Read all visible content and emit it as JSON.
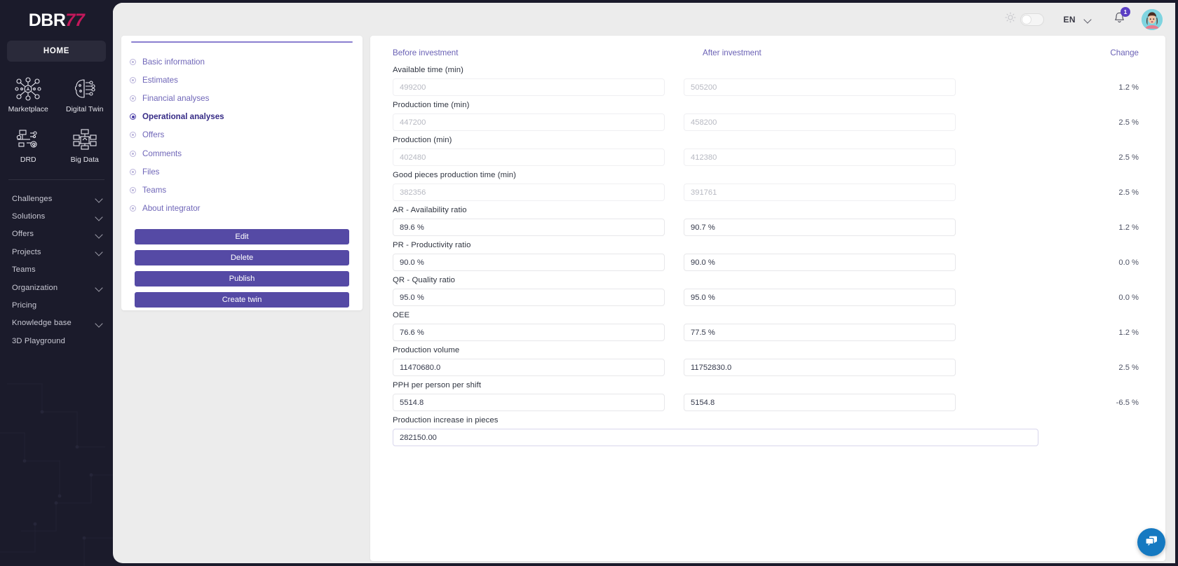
{
  "brand": {
    "name_main": "DBR",
    "name_accent": "77"
  },
  "sidebar": {
    "home_label": "HOME",
    "quick_items": [
      {
        "label": "Marketplace",
        "icon": "marketplace-icon"
      },
      {
        "label": "Digital Twin",
        "icon": "digital-twin-icon"
      },
      {
        "label": "DRD",
        "icon": "drd-icon"
      },
      {
        "label": "Big Data",
        "icon": "big-data-icon"
      }
    ],
    "nav_items": [
      {
        "label": "Challenges",
        "expandable": true
      },
      {
        "label": "Solutions",
        "expandable": true
      },
      {
        "label": "Offers",
        "expandable": true
      },
      {
        "label": "Projects",
        "expandable": true
      },
      {
        "label": "Teams",
        "expandable": false
      },
      {
        "label": "Organization",
        "expandable": true
      },
      {
        "label": "Pricing",
        "expandable": false
      },
      {
        "label": "Knowledge base",
        "expandable": true
      },
      {
        "label": "3D Playground",
        "expandable": false
      }
    ]
  },
  "topbar": {
    "sun_icon": "sun-icon",
    "theme_toggle": "theme-toggle",
    "language": "EN",
    "bell_icon": "bell-icon",
    "notification_count": "1",
    "avatar": "user-avatar"
  },
  "left_panel": {
    "sections": [
      {
        "label": "Basic information",
        "active": false
      },
      {
        "label": "Estimates",
        "active": false
      },
      {
        "label": "Financial analyses",
        "active": false
      },
      {
        "label": "Operational analyses",
        "active": true
      },
      {
        "label": "Offers",
        "active": false
      },
      {
        "label": "Comments",
        "active": false
      },
      {
        "label": "Files",
        "active": false
      },
      {
        "label": "Teams",
        "active": false
      },
      {
        "label": "About integrator",
        "active": false
      }
    ],
    "buttons": [
      {
        "label": "Edit"
      },
      {
        "label": "Delete"
      },
      {
        "label": "Publish"
      },
      {
        "label": "Create twin"
      }
    ]
  },
  "main": {
    "columns": {
      "before": "Before investment",
      "after": "After investment",
      "change": "Change"
    },
    "rows": [
      {
        "label": "Available time (min)",
        "before": "499200",
        "after": "505200",
        "change": "1.2 %",
        "muted": true
      },
      {
        "label": "Production time (min)",
        "before": "447200",
        "after": "458200",
        "change": "2.5 %",
        "muted": true
      },
      {
        "label": "Production (min)",
        "before": "402480",
        "after": "412380",
        "change": "2.5 %",
        "muted": true
      },
      {
        "label": "Good pieces production time (min)",
        "before": "382356",
        "after": "391761",
        "change": "2.5 %",
        "muted": true
      },
      {
        "label": "AR - Availability ratio",
        "before": "89.6 %",
        "after": "90.7 %",
        "change": "1.2 %",
        "muted": false
      },
      {
        "label": "PR - Productivity ratio",
        "before": "90.0 %",
        "after": "90.0 %",
        "change": "0.0 %",
        "muted": false
      },
      {
        "label": "QR - Quality ratio",
        "before": "95.0 %",
        "after": "95.0 %",
        "change": "0.0 %",
        "muted": false
      },
      {
        "label": "OEE",
        "before": "76.6 %",
        "after": "77.5 %",
        "change": "1.2 %",
        "muted": false
      },
      {
        "label": "Production volume",
        "before": "11470680.0",
        "after": "11752830.0",
        "change": "2.5 %",
        "muted": false
      },
      {
        "label": "PPH per person per shift",
        "before": "5514.8",
        "after": "5154.8",
        "change": "-6.5 %",
        "muted": false
      }
    ],
    "wide_row": {
      "label": "Production increase in pieces",
      "value": "282150.00"
    }
  },
  "chat": {
    "icon": "chat-bubbles-icon"
  },
  "colors": {
    "sidebar_bg": "#1b1b2b",
    "accent_purple": "#554aa5",
    "link_purple": "#6a61b5",
    "badge_purple": "#5b3fc4",
    "brand_pink": "#c2185b",
    "chat_blue": "#1579c1"
  }
}
